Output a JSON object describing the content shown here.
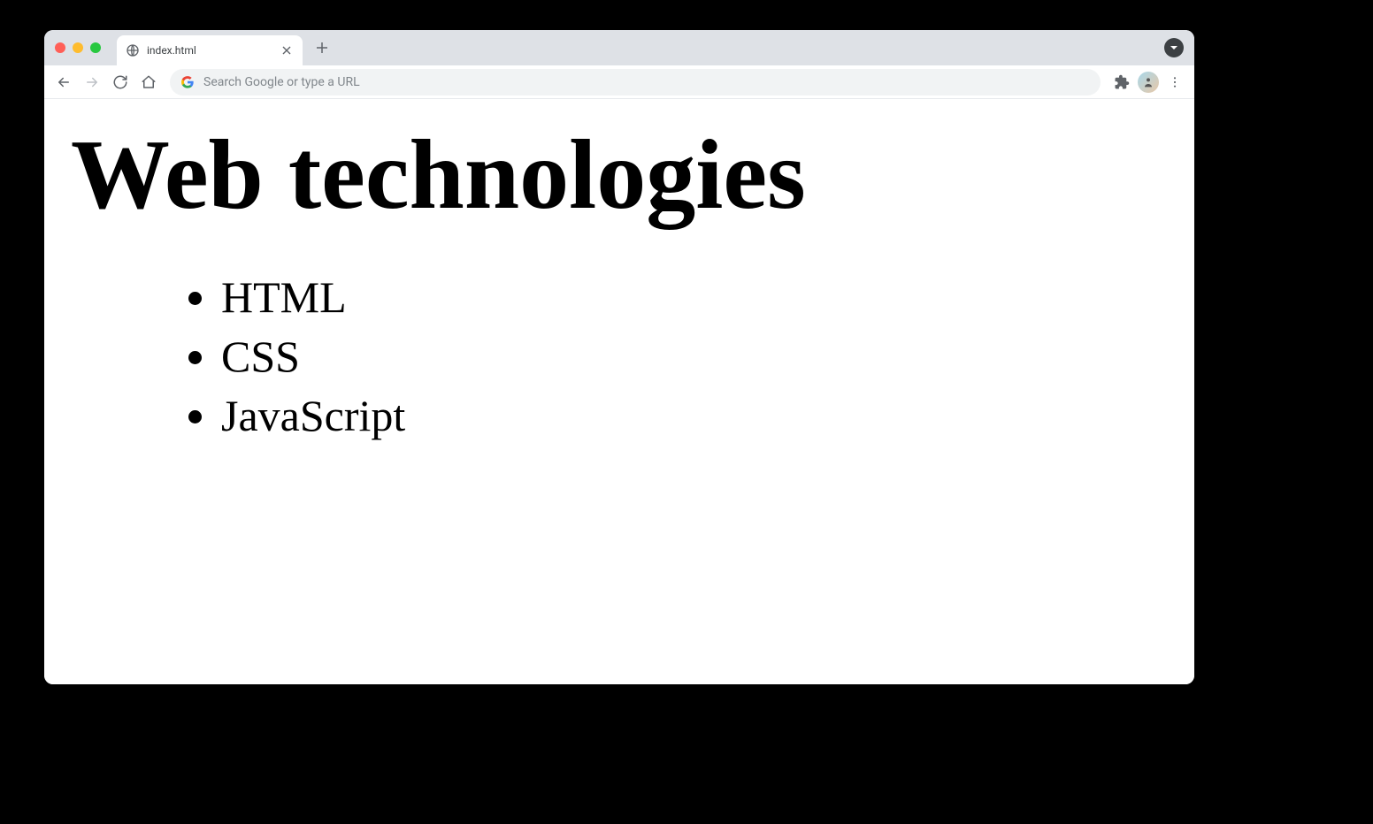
{
  "tab": {
    "title": "index.html"
  },
  "omnibox": {
    "placeholder": "Search Google or type a URL"
  },
  "page": {
    "heading": "Web technologies",
    "items": [
      "HTML",
      "CSS",
      "JavaScript"
    ]
  }
}
